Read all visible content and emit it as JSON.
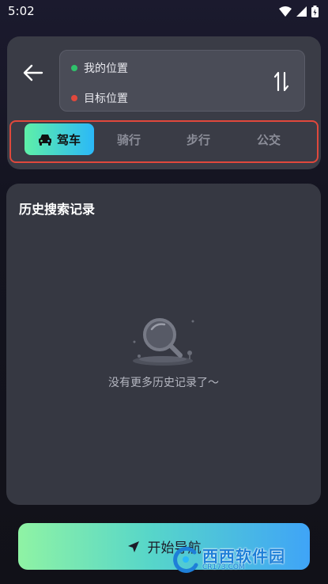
{
  "status_bar": {
    "time": "5:02"
  },
  "route": {
    "origin_label": "我的位置",
    "destination_placeholder": "目标位置",
    "origin_dot_color": "#2fc26b",
    "destination_dot_color": "#e0483c"
  },
  "modes": [
    {
      "label": "驾车",
      "icon": "car-icon",
      "active": true
    },
    {
      "label": "骑行",
      "active": false
    },
    {
      "label": "步行",
      "active": false
    },
    {
      "label": "公交",
      "active": false
    }
  ],
  "history": {
    "title": "历史搜索记录",
    "empty_text": "没有更多历史记录了～"
  },
  "start_button": {
    "label": "开始导航",
    "icon": "navigation-arrow-icon"
  },
  "watermark": {
    "text": "西西软件园",
    "sub": "CR173.COM"
  },
  "colors": {
    "accent_gradient_start": "#5ef0a8",
    "accent_gradient_end": "#2bb8f8",
    "highlight_outline": "#e0483c"
  }
}
